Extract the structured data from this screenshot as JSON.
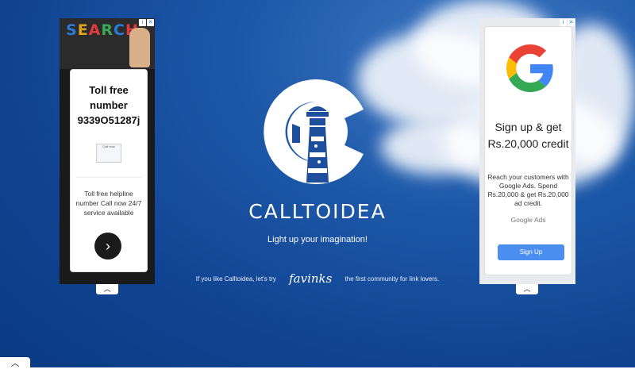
{
  "left_ad": {
    "banner_text": "SEARCH",
    "title": "Toll free number 9339O51287j",
    "mini_screen_text": "Call now",
    "description": "Toll free helpline number Call now 24/7 service available",
    "next_icon": "chevron-right-icon",
    "info_icon": "info-icon",
    "close_icon": "close-icon"
  },
  "right_ad": {
    "headline": "Sign up & get Rs.20,000 credit",
    "description": "Reach your customers with Google Ads. Spend Rs.20,000 & get Rs.20,000 ad credit.",
    "brand": "Google Ads",
    "button_label": "Sign Up",
    "info_icon": "info-icon",
    "close_icon": "close-icon"
  },
  "site": {
    "name": "CALLTOIDEA",
    "tagline": "Light up your imagination!",
    "promo_prefix": "If you like Calltoidea, let's try",
    "promo_brand": "favinks",
    "promo_suffix": "the first community for link lovers."
  },
  "colors": {
    "background": "#1d58a8",
    "logo_blue": "#1d4f9c",
    "google_button": "#4a8ff0"
  }
}
